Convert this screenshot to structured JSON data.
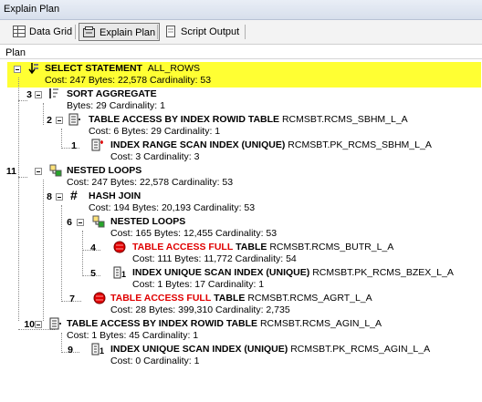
{
  "window": {
    "title": "Explain Plan"
  },
  "toolbar": {
    "tabs": [
      {
        "label": "Data Grid"
      },
      {
        "label": "Explain Plan"
      },
      {
        "label": "Script Output"
      }
    ]
  },
  "section_label": "Plan",
  "plan": [
    {
      "num": "",
      "op": "SELECT STATEMENT",
      "obj": "ALL_ROWS",
      "detail": "Cost: 247  Bytes: 22,578  Cardinality: 53"
    },
    {
      "num": "3",
      "op": "SORT AGGREGATE",
      "obj": "",
      "detail": "Bytes: 29  Cardinality: 1"
    },
    {
      "num": "2",
      "op": "TABLE ACCESS BY INDEX ROWID TABLE",
      "obj": "RCMSBT.RCMS_SBHM_L_A",
      "detail": "Cost: 6  Bytes: 29  Cardinality: 1"
    },
    {
      "num": "1",
      "op": "INDEX RANGE SCAN INDEX (UNIQUE)",
      "obj": "RCMSBT.PK_RCMS_SBHM_L_A",
      "detail": "Cost: 3  Cardinality: 3"
    },
    {
      "num": "11",
      "op": "NESTED LOOPS",
      "obj": "",
      "detail": "Cost: 247  Bytes: 22,578  Cardinality: 53"
    },
    {
      "num": "8",
      "op": "HASH JOIN",
      "obj": "",
      "detail": "Cost: 194  Bytes: 20,193  Cardinality: 53"
    },
    {
      "num": "6",
      "op": "NESTED LOOPS",
      "obj": "",
      "detail": "Cost: 165  Bytes: 12,455  Cardinality: 53"
    },
    {
      "num": "4",
      "op_red": "TABLE ACCESS FULL",
      "op": "TABLE",
      "obj": "RCMSBT.RCMS_BUTR_L_A",
      "detail": "Cost: 111  Bytes: 11,772  Cardinality: 54"
    },
    {
      "num": "5",
      "op": "INDEX UNIQUE SCAN INDEX (UNIQUE)",
      "obj": "RCMSBT.PK_RCMS_BZEX_L_A",
      "detail": "Cost: 1  Bytes: 17  Cardinality: 1"
    },
    {
      "num": "7",
      "op_red": "TABLE ACCESS FULL",
      "op": "TABLE",
      "obj": "RCMSBT.RCMS_AGRT_L_A",
      "detail": "Cost: 28  Bytes: 399,310  Cardinality: 2,735"
    },
    {
      "num": "10",
      "op": "TABLE ACCESS BY INDEX ROWID TABLE",
      "obj": "RCMSBT.RCMS_AGIN_L_A",
      "detail": "Cost: 1  Bytes: 45  Cardinality: 1"
    },
    {
      "num": "9",
      "op": "INDEX UNIQUE SCAN INDEX (UNIQUE)",
      "obj": "RCMSBT.PK_RCMS_AGIN_L_A",
      "detail": "Cost: 0  Cardinality: 1"
    }
  ],
  "colors": {
    "highlight": "#ffff33",
    "full_scan": "#e00000"
  }
}
